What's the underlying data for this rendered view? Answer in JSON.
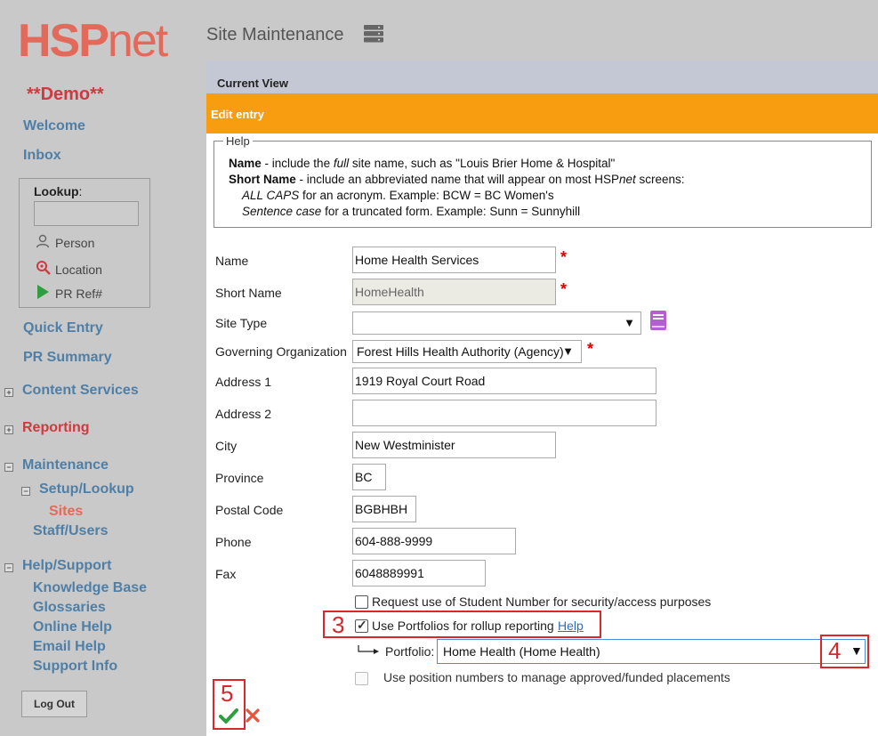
{
  "sidebar": {
    "logo_bold": "HSP",
    "logo_rest": "net",
    "demo": "**Demo**",
    "welcome": "Welcome",
    "inbox": "Inbox",
    "lookup_label": "Lookup",
    "lookup_colon": ":",
    "lookup_person": "Person",
    "lookup_location": "Location",
    "lookup_pr": "PR Ref#",
    "quick_entry": "Quick Entry",
    "pr_summary": "PR Summary",
    "content_services": "Content Services",
    "reporting": "Reporting",
    "maintenance": "Maintenance",
    "setup_lookup": "Setup/Lookup",
    "sites": "Sites",
    "staff_users": "Staff/Users",
    "help_support": "Help/Support",
    "knowledge_base": "Knowledge Base",
    "glossaries": "Glossaries",
    "online_help": "Online Help",
    "email_help": "Email Help",
    "support_info": "Support Info",
    "logout": "Log Out",
    "expand_plus": "+",
    "expand_minus": "−"
  },
  "header": {
    "title": "Site Maintenance"
  },
  "panel": {
    "current_view": "Current View",
    "edit_entry": "Edit entry"
  },
  "help_box": {
    "legend": "Help",
    "line1_bold": "Name",
    "line1_a": " - include the ",
    "line1_italic": "full",
    "line1_b": " site name, such as \"Louis Brier Home & Hospital\"",
    "line2_bold": "Short Name",
    "line2_a": " - include an abbreviated name that will appear on most HSP",
    "line2_italic": "net",
    "line2_b": " screens:",
    "line3_italic": "ALL CAPS",
    "line3_rest": " for an acronym. Example: BCW = BC Women's",
    "line4_italic": "Sentence case",
    "line4_rest": " for a truncated form. Example: Sunn = Sunnyhill"
  },
  "form": {
    "name_label": "Name",
    "name_value": "Home Health Services",
    "short_name_label": "Short Name",
    "short_name_value": "HomeHealth",
    "site_type_label": "Site Type",
    "site_type_value": "",
    "gov_org_label": "Governing Organization",
    "gov_org_value": "Forest Hills Health Authority (Agency)",
    "address1_label": "Address 1",
    "address1_value": "1919 Royal Court Road",
    "address2_label": "Address 2",
    "address2_value": "",
    "city_label": "City",
    "city_value": "New Westminister",
    "province_label": "Province",
    "province_value": "BC",
    "postal_label": "Postal Code",
    "postal_value": "BGBHBH",
    "phone_label": "Phone",
    "phone_value": "604-888-9999",
    "fax_label": "Fax",
    "fax_value": "6048889991",
    "required_mark": "*",
    "dropdown_arrow": "▼",
    "student_number_label": "Request use of Student Number for security/access purposes",
    "portfolios_label": "Use Portfolios for rollup reporting",
    "portfolios_help": "Help",
    "portfolio_label": "Portfolio:",
    "portfolio_value": "Home Health (Home Health)",
    "position_numbers_label": "Use position numbers to manage approved/funded placements"
  },
  "callouts": {
    "c3": "3",
    "c4": "4",
    "c5": "5"
  },
  "colors": {
    "accent_orange": "#f89c10",
    "nav_blue": "#4f7fa6",
    "brand_red": "#d0393f",
    "callout_red": "#d9272e",
    "save_green": "#2e9e3e",
    "cancel_orange": "#e8543a"
  }
}
